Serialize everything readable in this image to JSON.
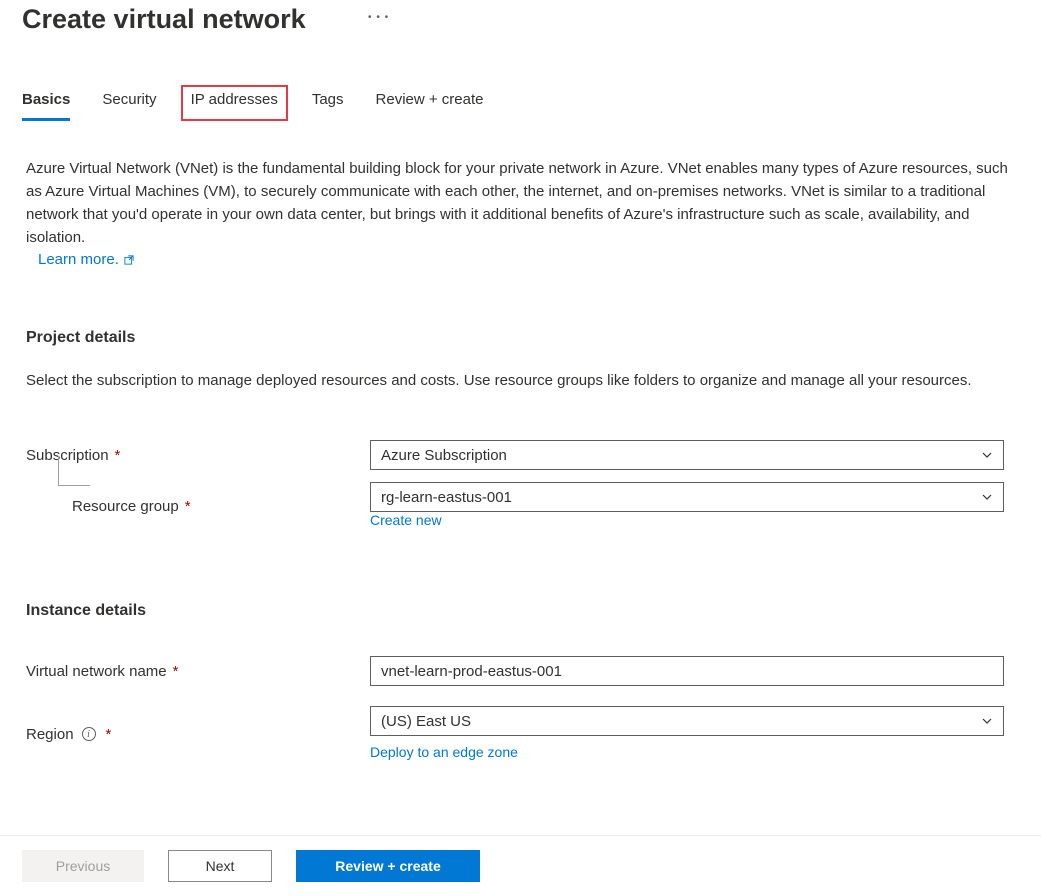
{
  "header": {
    "title": "Create virtual network"
  },
  "tabs": {
    "basics": "Basics",
    "security": "Security",
    "ip_addresses": "IP addresses",
    "tags": "Tags",
    "review_create": "Review + create"
  },
  "intro": {
    "description": "Azure Virtual Network (VNet) is the fundamental building block for your private network in Azure. VNet enables many types of Azure resources, such as Azure Virtual Machines (VM), to securely communicate with each other, the internet, and on-premises networks. VNet is similar to a traditional network that you'd operate in your own data center, but brings with it additional benefits of Azure's infrastructure such as scale, availability, and isolation.",
    "learn_more": "Learn more."
  },
  "project_details": {
    "title": "Project details",
    "description": "Select the subscription to manage deployed resources and costs. Use resource groups like folders to organize and manage all your resources.",
    "subscription_label": "Subscription",
    "subscription_value": "Azure Subscription",
    "resource_group_label": "Resource group",
    "resource_group_value": "rg-learn-eastus-001",
    "create_new": "Create new"
  },
  "instance_details": {
    "title": "Instance details",
    "vnet_name_label": "Virtual network name",
    "vnet_name_value": "vnet-learn-prod-eastus-001",
    "region_label": "Region",
    "region_value": "(US) East US",
    "deploy_edge": "Deploy to an edge zone"
  },
  "footer": {
    "previous": "Previous",
    "next": "Next",
    "review_create": "Review + create"
  },
  "colors": {
    "primary": "#0078d4",
    "required": "#a80000",
    "highlight_border": "#e63946"
  }
}
